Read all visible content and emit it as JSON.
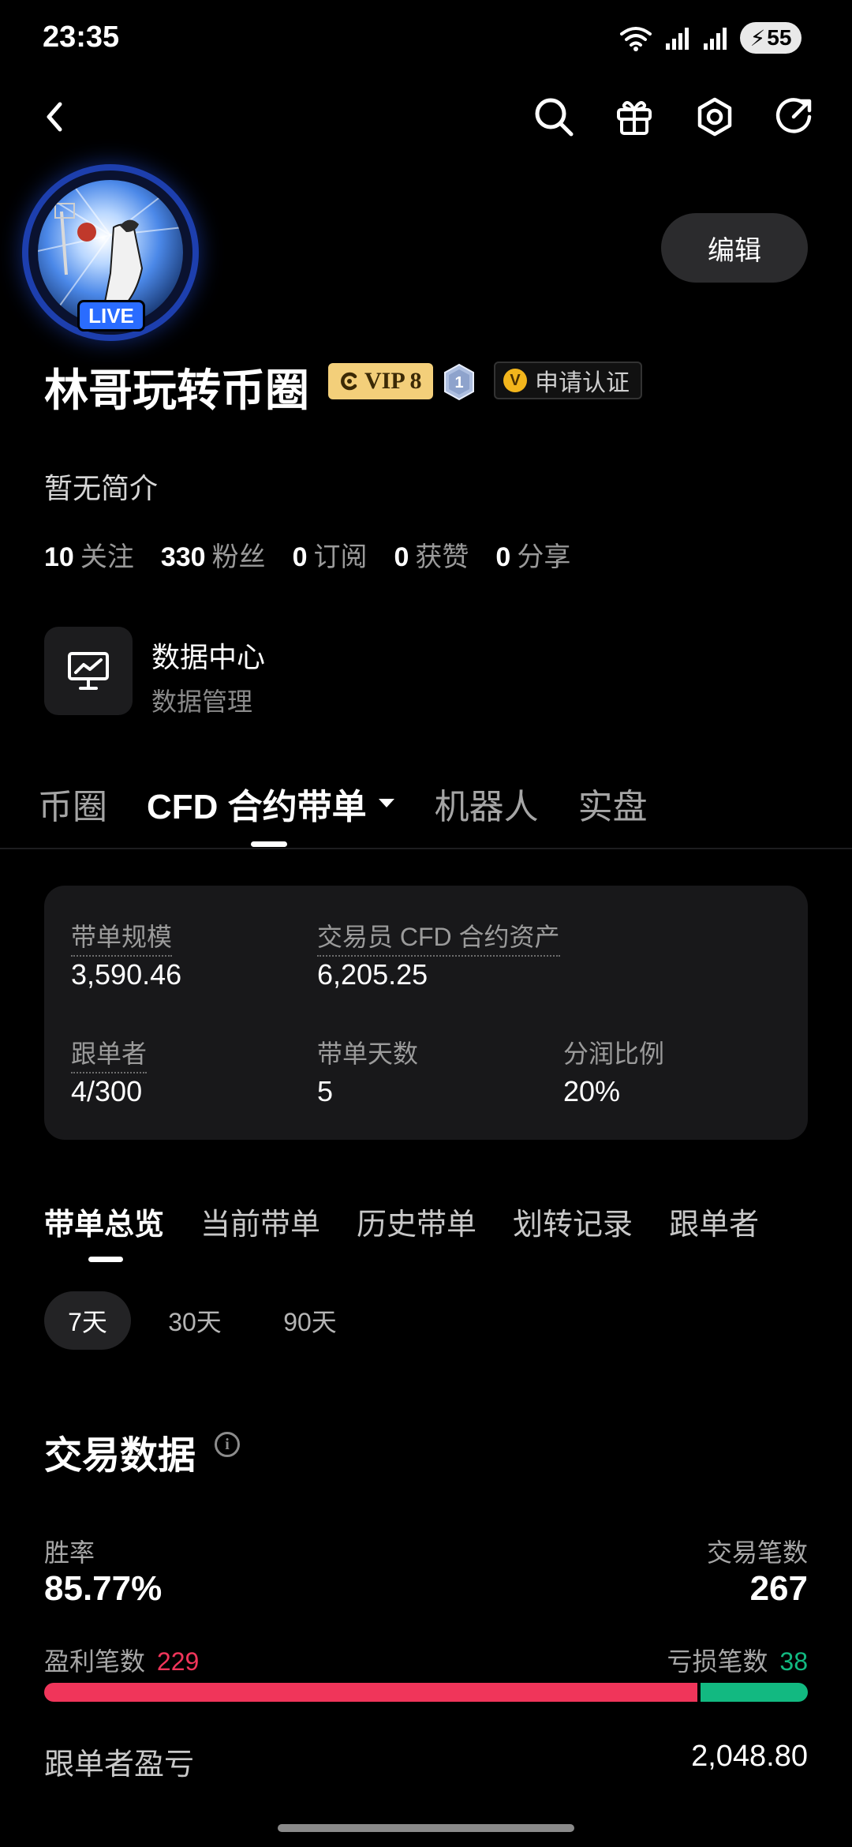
{
  "status_bar": {
    "time": "23:35",
    "battery": "55"
  },
  "profile": {
    "live_label": "LIVE",
    "edit_label": "编辑",
    "name": "林哥玩转币圈",
    "vip_label": "VIP 8",
    "level": "1",
    "verify_label": "申请认证",
    "bio": "暂无简介"
  },
  "stats": [
    {
      "num": "10",
      "label": "关注"
    },
    {
      "num": "330",
      "label": "粉丝"
    },
    {
      "num": "0",
      "label": "订阅"
    },
    {
      "num": "0",
      "label": "获赞"
    },
    {
      "num": "0",
      "label": "分享"
    }
  ],
  "data_center": {
    "title": "数据中心",
    "subtitle": "数据管理"
  },
  "main_tabs": [
    "币圈",
    "CFD 合约带单",
    "机器人",
    "实盘"
  ],
  "card": {
    "scale_label": "带单规模",
    "scale_value": "3,590.46",
    "assets_label": "交易员 CFD 合约资产",
    "assets_value": "6,205.25",
    "followers_label": "跟单者",
    "followers_value": "4/300",
    "days_label": "带单天数",
    "days_value": "5",
    "share_label": "分润比例",
    "share_value": "20%"
  },
  "sub_tabs": [
    "带单总览",
    "当前带单",
    "历史带单",
    "划转记录",
    "跟单者"
  ],
  "periods": [
    "7天",
    "30天",
    "90天"
  ],
  "trading": {
    "title": "交易数据",
    "win_rate_label": "胜率",
    "win_rate": "85.77%",
    "trades_label": "交易笔数",
    "trades": "267",
    "profit_label": "盈利笔数",
    "profit_count": "229",
    "loss_label": "亏损笔数",
    "loss_count": "38",
    "win_fraction": 0.8577,
    "follower_pnl_label": "跟单者盈亏",
    "follower_pnl": "2,048.80"
  },
  "colors": {
    "profit": "#f0355a",
    "loss": "#12b981",
    "vip_gold": "#f3cf7a",
    "live_blue": "#2a6cff"
  }
}
